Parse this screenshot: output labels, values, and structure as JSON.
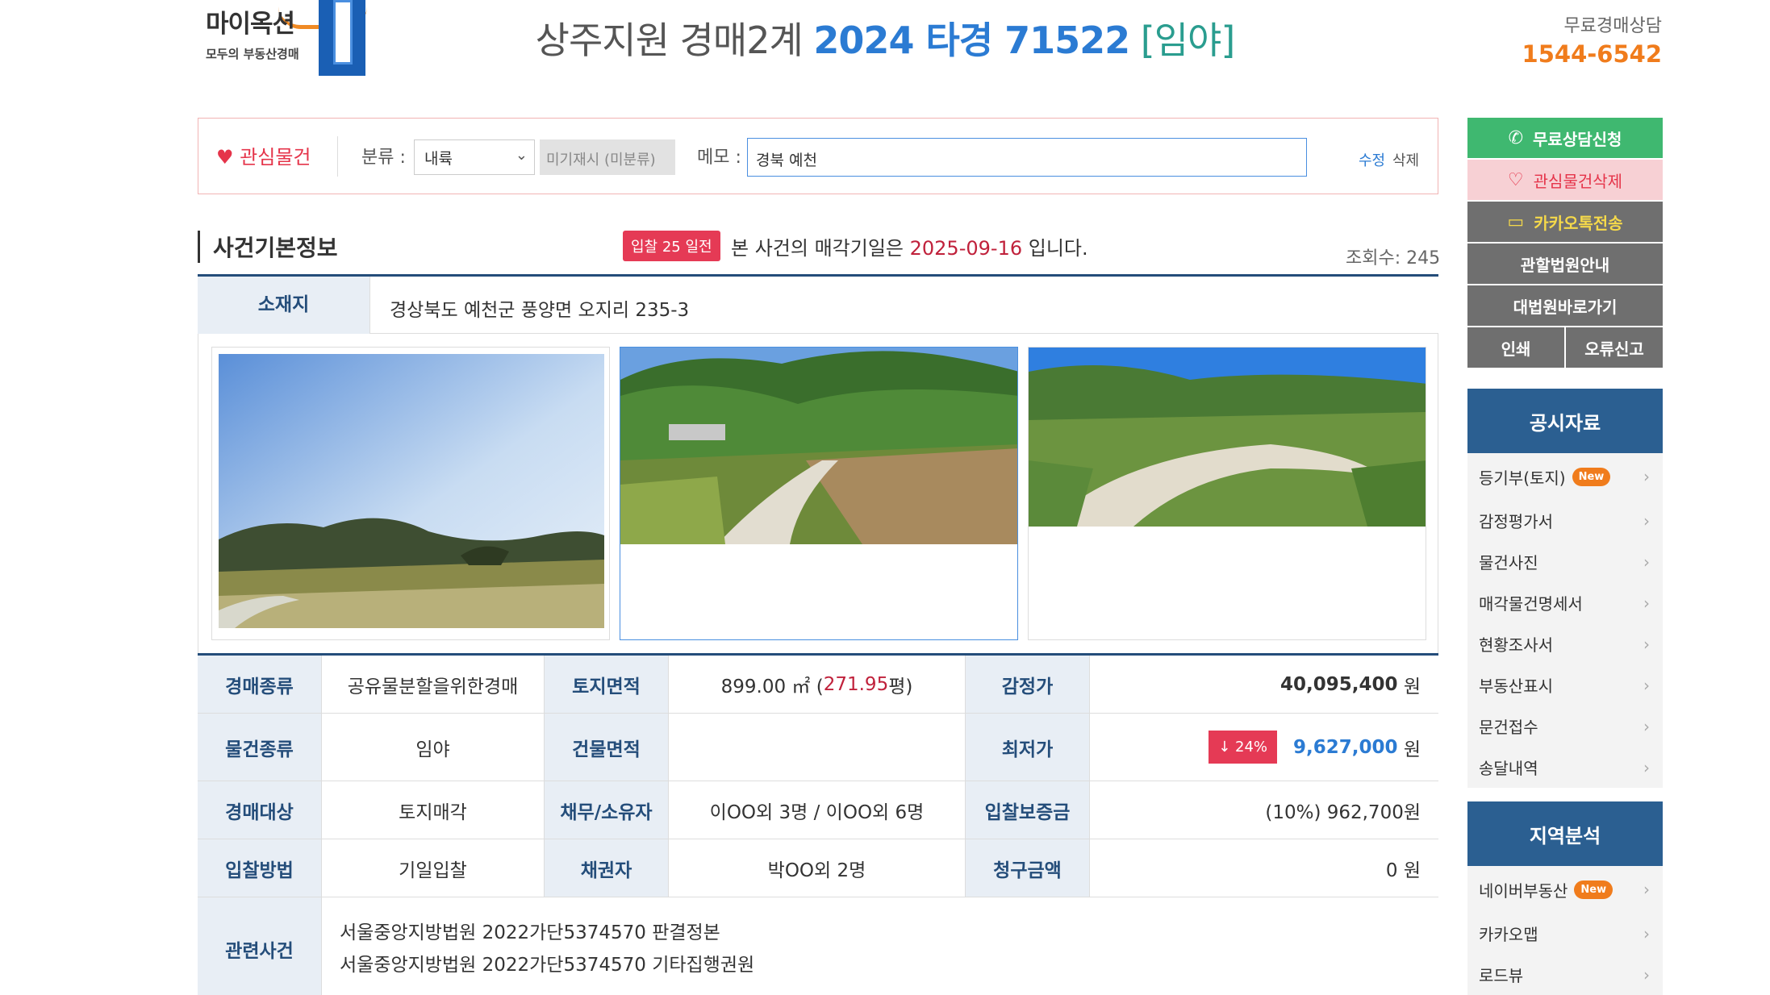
{
  "brand": {
    "name": "마이옥션",
    "tagline": "모두의 부동산경매"
  },
  "header": {
    "court": "상주지원 경매2계",
    "case_number": "2024 타경 71522",
    "kind": "[임야]",
    "consult_label": "무료경매상담",
    "consult_phone": "1544-6542"
  },
  "interest": {
    "label": "관심물건",
    "category_label": "분류 :",
    "category_value": "내륙",
    "unclassified": "미기재시 (미분류)",
    "memo_label": "메모 :",
    "memo_value": "경북 예천",
    "edit": "수정",
    "delete": "삭제"
  },
  "section": {
    "title": "사건기본정보",
    "days_badge": "입찰 25 일전",
    "sale_note_prefix": "본 사건의 매각기일은",
    "sale_date": "2025-09-16",
    "sale_note_suffix": "입니다.",
    "views": "조회수: 245"
  },
  "address": {
    "label": "소재지",
    "value": "경상북도 예천군 풍양면 오지리 235-3"
  },
  "details": {
    "r1": {
      "l1": "경매종류",
      "v1": "공유물분할을위한경매",
      "l2": "토지면적",
      "v2a": "899.00 ㎡ (",
      "v2b": "271.95",
      "v2c": "평)",
      "l3": "감정가",
      "v3": "40,095,400",
      "unit": "원"
    },
    "r2": {
      "l1": "물건종류",
      "v1": "임야",
      "l2": "건물면적",
      "v2": "",
      "l3": "최저가",
      "drop": "↓ 24%",
      "v3": "9,627,000",
      "unit": "원"
    },
    "r3": {
      "l1": "경매대상",
      "v1": "토지매각",
      "l2": "채무/소유자",
      "v2": "이OO외 3명 / 이OO외 6명",
      "l3": "입찰보증금",
      "v3": "(10%) 962,700원"
    },
    "r4": {
      "l1": "입찰방법",
      "v1": "기일입찰",
      "l2": "채권자",
      "v2": "박OO외 2명",
      "l3": "청구금액",
      "v3": "0 원"
    },
    "related": {
      "label": "관련사건",
      "line1": "서울중앙지방법원 2022가단5374570 판결정본",
      "line2": "서울중앙지방법원 2022가단5374570 기타집행권원"
    }
  },
  "sidebar": {
    "consult_btn": "무료상담신청",
    "interest_del": "관심물건삭제",
    "kakao": "카카오톡전송",
    "court_info": "관할법원안내",
    "supreme": "대법원바로가기",
    "print": "인쇄",
    "report": "오류신고",
    "public_head": "공시자료",
    "public_items": [
      "등기부(토지)",
      "감정평가서",
      "물건사진",
      "매각물건명세서",
      "현황조사서",
      "부동산표시",
      "문건접수",
      "송달내역"
    ],
    "new_badge": "New",
    "region_head": "지역분석",
    "region_items": [
      "네이버부동산",
      "카카오맵",
      "로드뷰"
    ]
  }
}
